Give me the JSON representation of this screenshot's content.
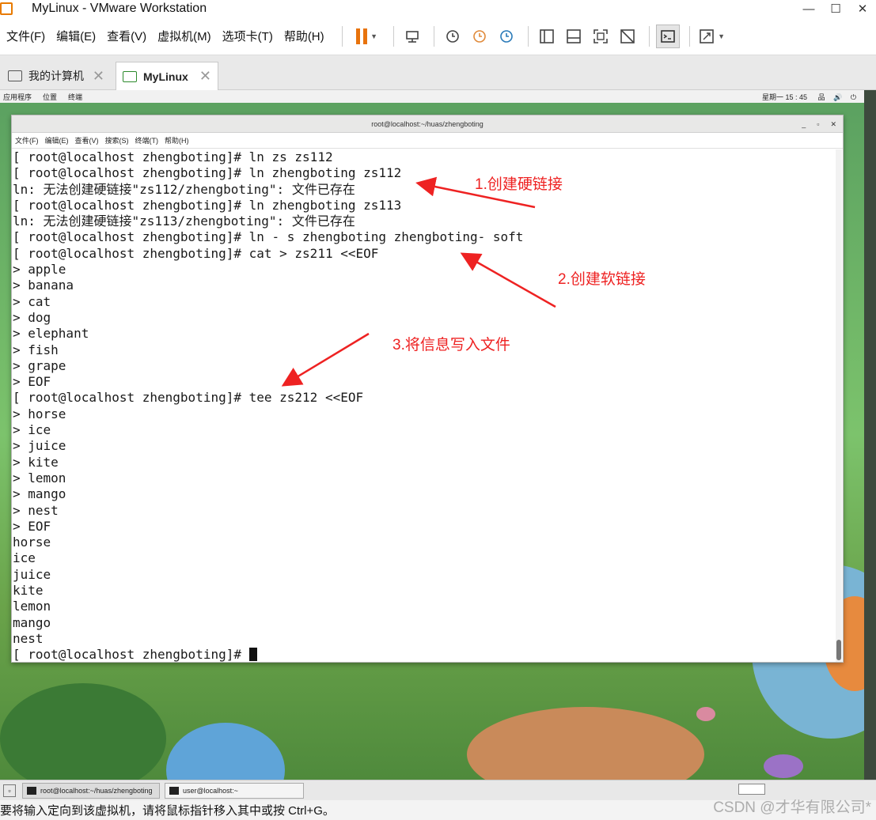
{
  "window": {
    "title": "MyLinux - VMware Workstation",
    "controls": [
      "—",
      "☐",
      "✕"
    ]
  },
  "menu": {
    "file": "文件(F)",
    "edit": "编辑(E)",
    "view": "查看(V)",
    "vm": "虚拟机(M)",
    "tabs": "选项卡(T)",
    "help": "帮助(H)"
  },
  "tabs": [
    {
      "label": "我的计算机"
    },
    {
      "label": "MyLinux"
    }
  ],
  "gnome": {
    "apps": "应用程序",
    "places": "位置",
    "terminal": "终端",
    "clock": "星期一 15 : 45",
    "sys": "品 🔊 ⏻"
  },
  "terminal": {
    "title": "root@localhost:~/huas/zhengboting",
    "menu": [
      "文件(F)",
      "编辑(E)",
      "查看(V)",
      "搜索(S)",
      "终端(T)",
      "帮助(H)"
    ],
    "lines": [
      "[ root@localhost zhengboting]# ln zs zs112",
      "[ root@localhost zhengboting]# ln zhengboting zs112",
      "ln: 无法创建硬链接\"zs112/zhengboting\": 文件已存在",
      "[ root@localhost zhengboting]# ln zhengboting zs113",
      "ln: 无法创建硬链接\"zs113/zhengboting\": 文件已存在",
      "[ root@localhost zhengboting]# ln - s zhengboting zhengboting- soft",
      "[ root@localhost zhengboting]# cat > zs211 <<EOF",
      "> apple",
      "> banana",
      "> cat",
      "> dog",
      "> elephant",
      "> fish",
      "> grape",
      "> EOF",
      "[ root@localhost zhengboting]# tee zs212 <<EOF",
      "> horse",
      "> ice",
      "> juice",
      "> kite",
      "> lemon",
      "> mango",
      "> nest",
      "> EOF",
      "horse",
      "ice",
      "juice",
      "kite",
      "lemon",
      "mango",
      "nest"
    ],
    "prompt": "[ root@localhost zhengboting]# "
  },
  "annotations": [
    {
      "text": "1.创建硬链接"
    },
    {
      "text": "2.创建软链接"
    },
    {
      "text": "3.将信息写入文件"
    }
  ],
  "annotation_color": "#ee2222",
  "taskbar": {
    "tasks": [
      {
        "label": "root@localhost:~/huas/zhengboting"
      },
      {
        "label": "user@localhost:~"
      }
    ]
  },
  "status": {
    "text": "要将输入定向到该虚拟机，请将鼠标指针移入其中或按 Ctrl+G。"
  },
  "watermark": "CSDN @才华有限公司*"
}
